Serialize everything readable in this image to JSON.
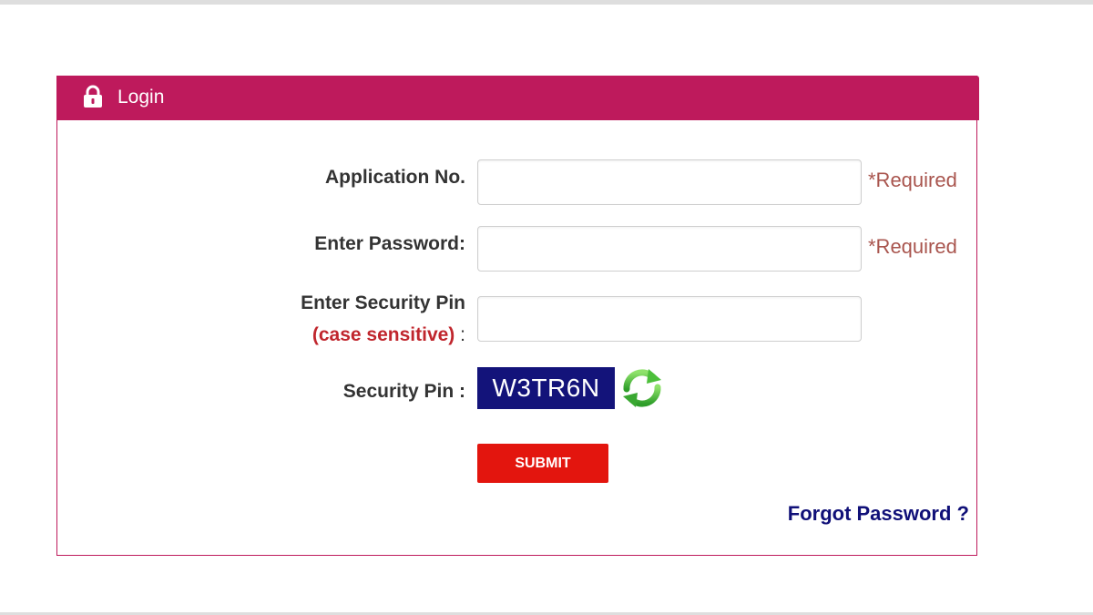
{
  "panel": {
    "title": "Login",
    "header_color": "#be1a5c",
    "header_icon": "lock-icon"
  },
  "form": {
    "application_no": {
      "label": "Application No.",
      "value": "",
      "required_text": "*Required"
    },
    "password": {
      "label": "Enter Password:",
      "value": "",
      "required_text": "*Required"
    },
    "security_pin_input": {
      "label": "Enter Security Pin",
      "note": "(case sensitive)",
      "colon": ":",
      "value": ""
    },
    "captcha": {
      "label": "Security Pin :",
      "code": "W3TR6N",
      "refresh_icon": "refresh-icon"
    },
    "submit_label": "SUBMIT",
    "forgot_password_label": "Forgot Password ?"
  },
  "colors": {
    "accent": "#be1a5c",
    "required": "#a9554e",
    "case_note": "#c0262d",
    "captcha_bg": "#13137a",
    "submit_bg": "#e3150e",
    "link": "#101078"
  }
}
